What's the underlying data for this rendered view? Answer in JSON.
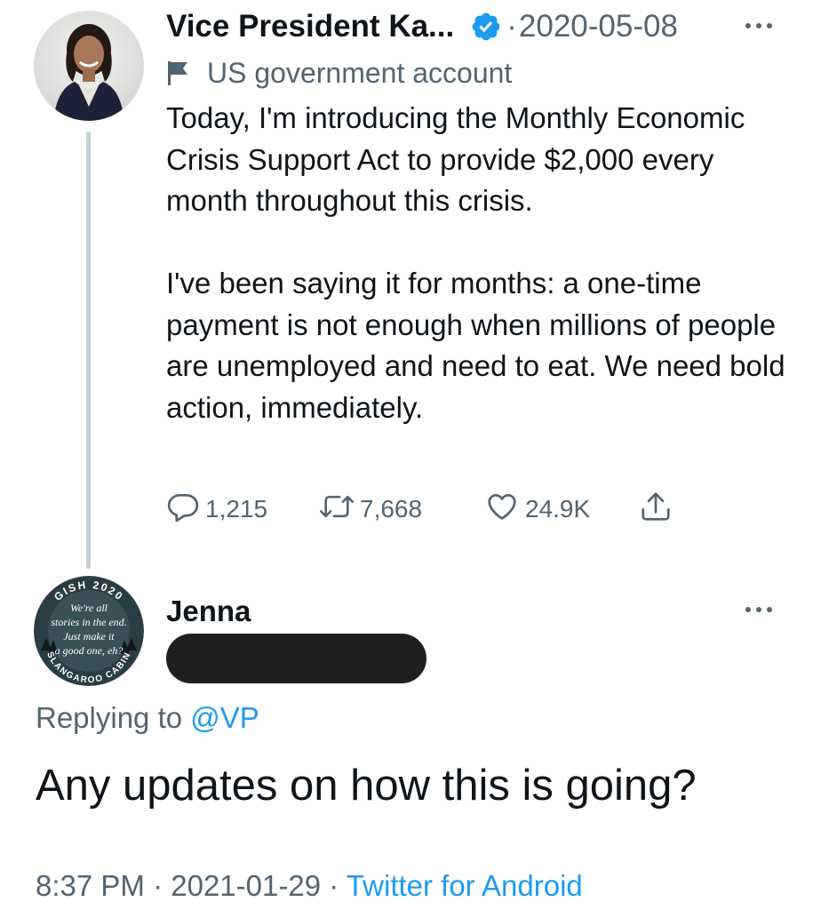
{
  "parent_tweet": {
    "display_name": "Vice President Ka...",
    "verified_icon": "verified-badge-icon",
    "separator": "·",
    "date": "2020-05-08",
    "more_icon": "more-options-icon",
    "account_label_icon": "flag-icon",
    "account_label": "US government account",
    "paragraphs": [
      "Today, I'm introducing the Monthly Economic Crisis Support Act to provide $2,000 every month throughout this crisis.",
      "I've been saying it for months: a one-time payment is not enough when millions of people are unemployed and need to eat. We need bold action, immediately."
    ],
    "actions": {
      "reply_count": "1,215",
      "retweet_count": "7,668",
      "like_count": "24.9K"
    }
  },
  "reply_tweet": {
    "display_name": "Jenna",
    "more_icon": "more-options-icon",
    "avatar_text": {
      "top_arc": "GISH 2020",
      "bottom_arc": "SLANGAROO CABIN",
      "lines": [
        "We're all",
        "stories in the end.",
        "Just make it",
        "a good one, eh?"
      ]
    },
    "replying_to_prefix": "Replying to",
    "replying_to_handle": "@VP",
    "text": "Any updates on how this is going?",
    "time": "8:37 PM",
    "date": "2021-01-29",
    "separator": "·",
    "source": "Twitter for Android"
  },
  "colors": {
    "primary_text": "#0f1419",
    "secondary_text": "#536471",
    "accent": "#1d9bf0",
    "thread_line": "#c4cfd6",
    "redaction": "#1f1f1f"
  }
}
